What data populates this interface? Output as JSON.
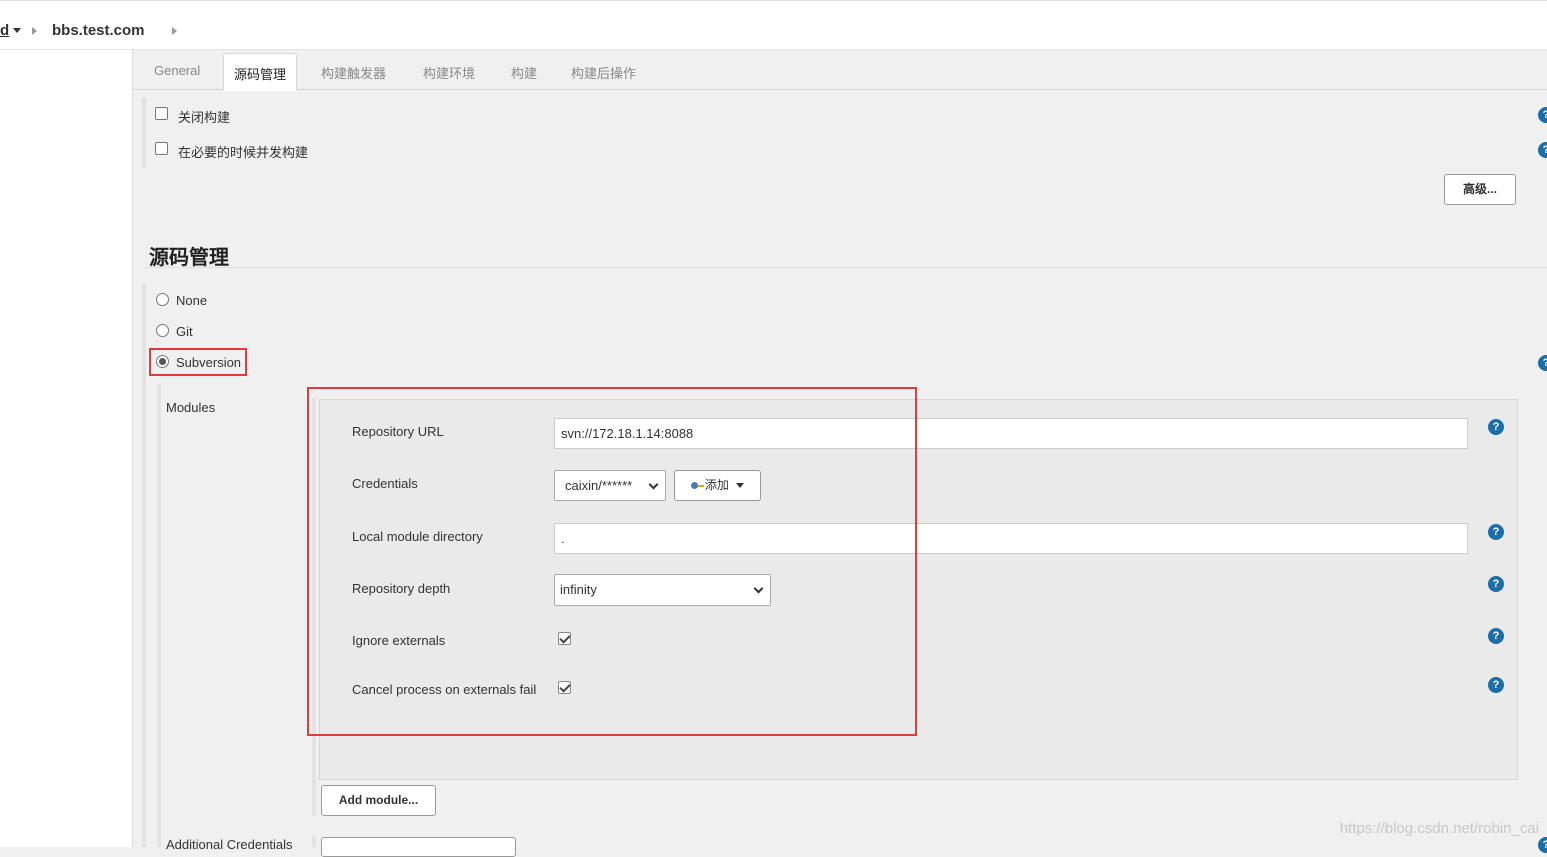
{
  "breadcrumb": {
    "previous": "d",
    "current": "bbs.test.com"
  },
  "tabs": [
    {
      "label": "General",
      "active": false
    },
    {
      "label": "源码管理",
      "active": true
    },
    {
      "label": "构建触发器",
      "active": false
    },
    {
      "label": "构建环境",
      "active": false
    },
    {
      "label": "构建",
      "active": false
    },
    {
      "label": "构建后操作",
      "active": false
    }
  ],
  "general_options": {
    "disable_build": {
      "label": "关闭构建",
      "checked": false
    },
    "concurrent_build": {
      "label": "在必要的时候并发构建",
      "checked": false
    },
    "advanced_button": "高级..."
  },
  "scm": {
    "title": "源码管理",
    "options": [
      {
        "label": "None",
        "selected": false
      },
      {
        "label": "Git",
        "selected": false
      },
      {
        "label": "Subversion",
        "selected": true
      }
    ],
    "modules_label": "Modules",
    "repository_url": {
      "label": "Repository URL",
      "value": "svn://172.18.1.14:8088"
    },
    "credentials": {
      "label": "Credentials",
      "value": "caixin/******",
      "add_button": "添加"
    },
    "local_module_directory": {
      "label": "Local module directory",
      "value": "."
    },
    "repository_depth": {
      "label": "Repository depth",
      "value": "infinity"
    },
    "ignore_externals": {
      "label": "Ignore externals",
      "checked": true
    },
    "cancel_on_externals_fail": {
      "label": "Cancel process on externals fail",
      "checked": true
    },
    "add_module_button": "Add module...",
    "additional_credentials_label": "Additional Credentials"
  },
  "help_glyph": "?",
  "watermark": "https://blog.csdn.net/robin_cai",
  "colors": {
    "highlight_red": "#e03c3c",
    "help_blue": "#1b6ea8"
  }
}
